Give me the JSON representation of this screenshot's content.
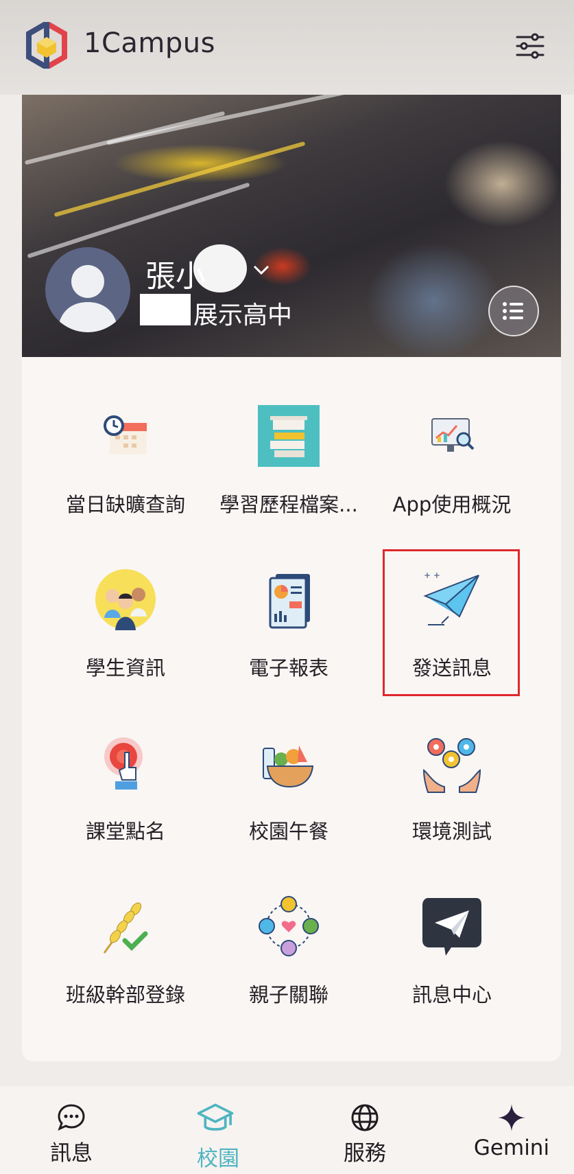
{
  "app": {
    "title": "1Campus",
    "logo": "1campus-logo-icon",
    "settings_icon": "tune-sliders-icon"
  },
  "profile": {
    "name": "張小",
    "school": "展示高中"
  },
  "apps": [
    {
      "label": "當日缺曠查詢",
      "icon": "attendance-clock-calendar-icon"
    },
    {
      "label": "學習歷程檔案...",
      "icon": "learning-portfolio-icon"
    },
    {
      "label": "App使用概況",
      "icon": "usage-chart-monitor-icon"
    },
    {
      "label": "學生資訊",
      "icon": "students-group-icon"
    },
    {
      "label": "電子報表",
      "icon": "report-document-icon"
    },
    {
      "label": "發送訊息",
      "icon": "paper-plane-icon"
    },
    {
      "label": "課堂點名",
      "icon": "tap-roll-call-icon"
    },
    {
      "label": "校園午餐",
      "icon": "lunch-basket-icon"
    },
    {
      "label": "環境測試",
      "icon": "gears-hands-icon"
    },
    {
      "label": "班級幹部登錄",
      "icon": "wheat-check-icon"
    },
    {
      "label": "親子關聯",
      "icon": "family-connection-icon"
    },
    {
      "label": "訊息中心",
      "icon": "message-center-plane-icon"
    }
  ],
  "highlighted_item": "發送訊息",
  "bottom_nav": [
    {
      "label": "訊息",
      "icon": "chat-bubble-icon",
      "active": false
    },
    {
      "label": "校園",
      "icon": "school-cap-icon",
      "active": true
    },
    {
      "label": "服務",
      "icon": "globe-icon",
      "active": false
    },
    {
      "label": "Gemini",
      "icon": "gemini-sparkle-icon",
      "active": false
    }
  ],
  "colors": {
    "accent": "#4fb5c1",
    "highlight_border": "#e0282c",
    "card": "#f9f6f4",
    "avatar": "#5d6585"
  }
}
